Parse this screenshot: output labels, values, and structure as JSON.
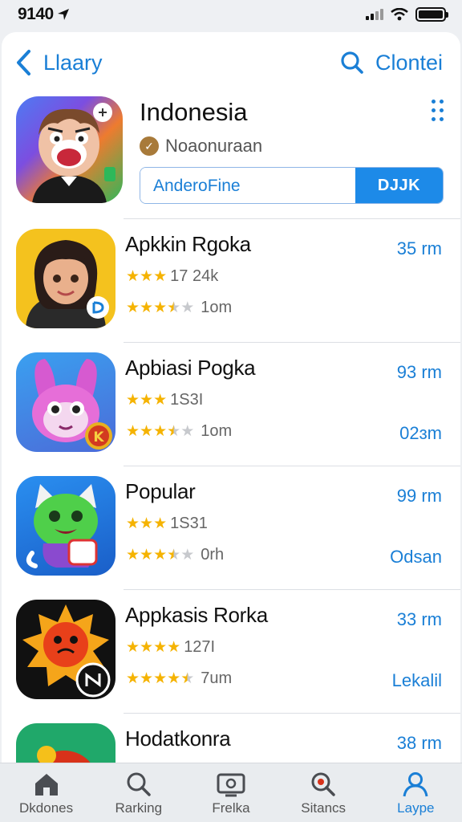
{
  "status_bar": {
    "time": "9140"
  },
  "nav": {
    "back_label": "Llaary",
    "search_label": "Clontei"
  },
  "hero": {
    "title": "Indonesia",
    "developer": "Noaonuraan",
    "input_value": "AnderoFine",
    "button_label": "DJJK"
  },
  "apps": [
    {
      "title": "Apkkin Rgoka",
      "size": "35 rm",
      "rating_count": "17 24k",
      "meta": "1om",
      "action": ""
    },
    {
      "title": "Apbiasi Pogka",
      "size": "93 rm",
      "rating_count": "1S3I",
      "meta": "1om",
      "action": "02ɜm"
    },
    {
      "title": "Popular",
      "size": "99 rm",
      "rating_count": "1S31",
      "meta": "0rh",
      "action": "Odsan"
    },
    {
      "title": "Appkasis Rorka",
      "size": "33 rm",
      "rating_count": "127I",
      "meta": "7um",
      "action": "Lekalil"
    },
    {
      "title": "Hodatkonra",
      "size": "38 rm",
      "rating_count": "",
      "meta": "",
      "action": ""
    }
  ],
  "tabs": [
    {
      "label": "Dkdones",
      "icon": "home-icon"
    },
    {
      "label": "Rarking",
      "icon": "search-icon"
    },
    {
      "label": "Frelka",
      "icon": "tv-icon"
    },
    {
      "label": "Sitancs",
      "icon": "search-icon"
    },
    {
      "label": "Laype",
      "icon": "person-icon"
    }
  ],
  "colors": {
    "accent": "#1a7fd6",
    "star": "#f5b301",
    "button": "#1d8ae8"
  }
}
